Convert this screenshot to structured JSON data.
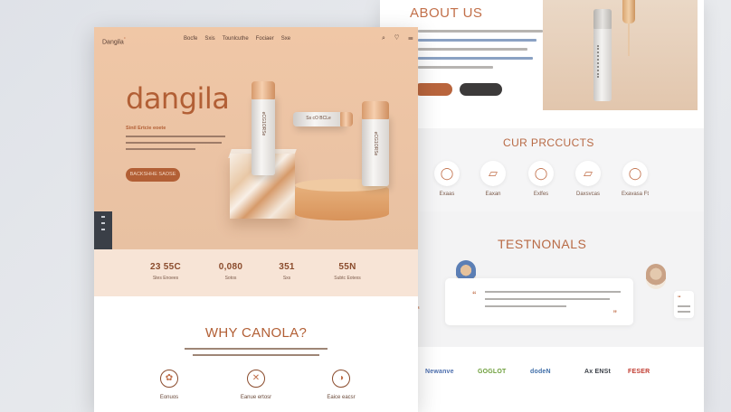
{
  "about": {
    "title": "ABOUT US"
  },
  "products": {
    "title": "CUR PRCCUCTS",
    "items": [
      {
        "label": "Exaas",
        "icon": "bottle-icon"
      },
      {
        "label": "Eaxan",
        "icon": "jar-icon"
      },
      {
        "label": "Exlfes",
        "icon": "tube-icon"
      },
      {
        "label": "Daxsvcas",
        "icon": "bottle-icon"
      },
      {
        "label": "Exavasa Ft",
        "icon": "dropper-icon"
      }
    ]
  },
  "testimonials": {
    "title": "TESTNONALS",
    "quote_open": "“",
    "quote_close": "”"
  },
  "logos": [
    {
      "name": "Newanve",
      "color": "#4d6fae"
    },
    {
      "name": "GOGLOT",
      "color": "#6e9f3c"
    },
    {
      "name": "dodeN",
      "color": "#3f6ea8"
    },
    {
      "name": "Ax ENSt",
      "color": "#3a3f47"
    },
    {
      "name": "FESER",
      "color": "#c03a2f"
    }
  ],
  "front": {
    "nav_logo": "Dangila",
    "nav_logo_mark": "°",
    "nav": [
      "Bocfe",
      "Sxis",
      "Tounlcuthe",
      "Fociaer",
      "Sxe"
    ],
    "nav_icons": "⌕ ♡ ☰",
    "brand": "dangila",
    "subtitle": "Sinil Ertcie eoete",
    "hero_button": "BACKSHHE  SAOSE",
    "bottle_text": "eCG1ORSe",
    "bottle_text_2": "Ss cO BCLe",
    "stats": [
      {
        "value": "23 55C",
        "label": "Stes Enoees"
      },
      {
        "value": "0,080",
        "label": "Sotos"
      },
      {
        "value": "351",
        "label": "Sxs"
      },
      {
        "value": "55N",
        "label": "Subtc Eotexs"
      }
    ],
    "why": {
      "title": "WHY CANOLA?",
      "features": [
        {
          "label": "Eonuos",
          "icon": "leaf-icon"
        },
        {
          "label": "Eanue ertosr",
          "icon": "no-cruelty-icon"
        },
        {
          "label": "Eaice eacsr",
          "icon": "drop-icon"
        }
      ]
    }
  }
}
